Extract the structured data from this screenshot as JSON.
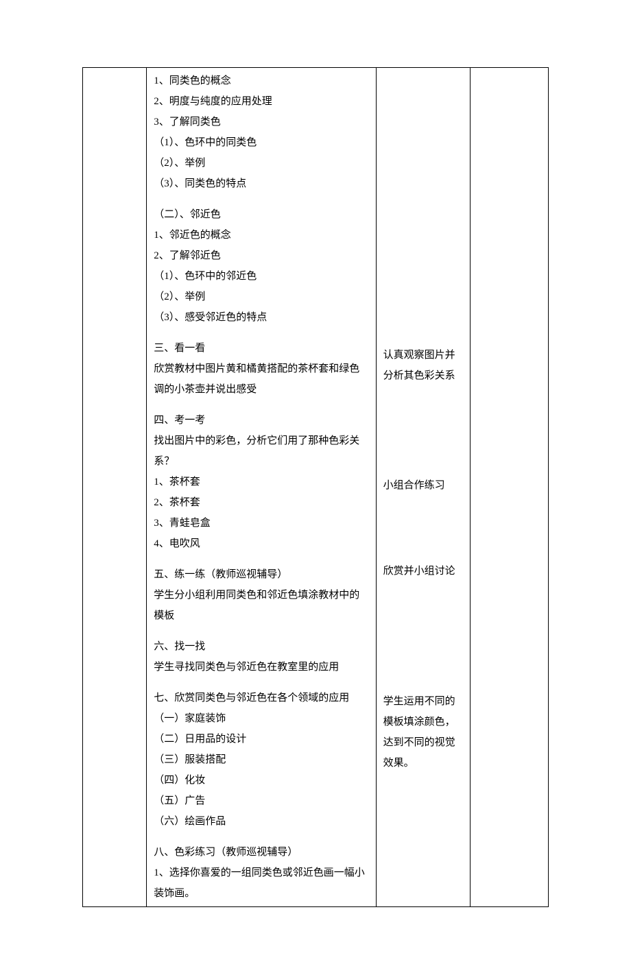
{
  "col2": {
    "part1": [
      "1、同类色的概念",
      "2、明度与纯度的应用处理",
      "3、了解同类色",
      "（1）、色环中的同类色",
      "（2）、举例",
      "（3）、同类色的特点"
    ],
    "part2": [
      "（二）、邻近色",
      "1、邻近色的概念",
      "2、了解邻近色",
      "（1）、色环中的邻近色",
      "（2）、举例",
      "（3）、感受邻近色的特点"
    ],
    "sec3_head": "三、看一看",
    "sec3_body": "欣赏教材中图片黄和橘黄搭配的茶杯套和绿色调的小茶壶并说出感受",
    "sec4_head": "四、考一考",
    "sec4_body": "找出图片中的彩色，分析它们用了那种色彩关系？",
    "sec4_items": [
      "1、茶杯套",
      "2、茶杯套",
      "3、青蛙皂盒",
      "4、电吹风"
    ],
    "sec5_head": "五、练一练（教师巡视辅导）",
    "sec5_body": "学生分小组利用同类色和邻近色填涂教材中的模板",
    "sec6_head": "六、找一找",
    "sec6_body": "学生寻找同类色与邻近色在教室里的应用",
    "sec7_head": "七、欣赏同类色与邻近色在各个领域的应用",
    "sec7_items": [
      "（一）家庭装饰",
      "（二）日用品的设计",
      "（三）服装搭配",
      "（四）化妆",
      "（五）广告",
      "（六）绘画作品"
    ],
    "sec8_head": "八、色彩练习（教师巡视辅导）",
    "sec8_item1": "1、选择你喜爱的一组同类色或邻近色画一幅小装饰画。"
  },
  "col3": {
    "annot1": "认真观察图片并分析其色彩关系",
    "annot2": "小组合作练习",
    "annot3": "欣赏并小组讨论",
    "annot4": "学生运用不同的模板填涂颜色，达到不同的视觉效果。"
  }
}
